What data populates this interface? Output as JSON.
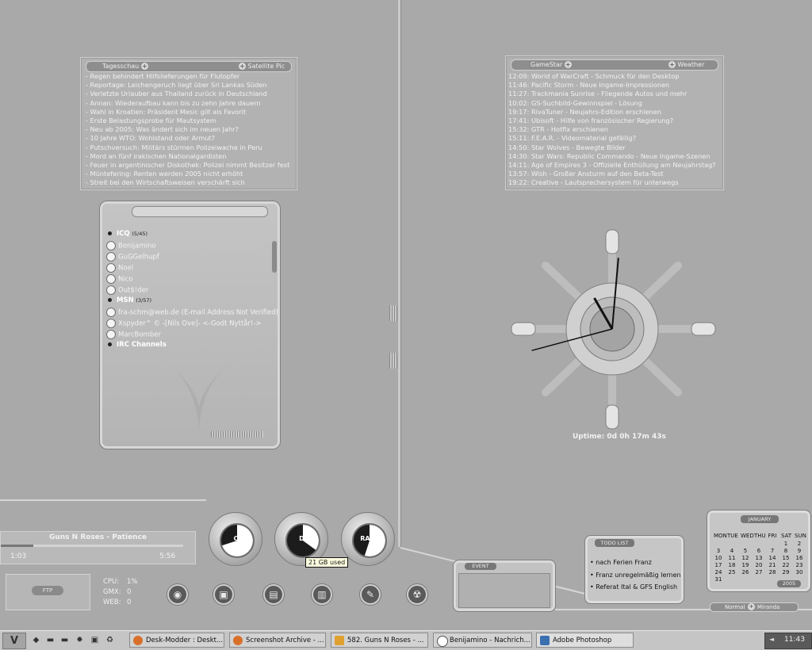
{
  "news_panel": {
    "left_tab": "Tagesschau",
    "right_tab": "Satellite Pic",
    "items": [
      "- Regen behindert Hilfslieferungen für Flutopfer",
      "- Reportage: Leichengeruch liegt über Sri Lankas Süden",
      "- Verletzte Urlauber aus Thailand zurück in Deutschland",
      "- Annan: Wiederaufbau kann bis zu zehn Jahre dauern",
      "- Wahl in Kroatien: Präsident Mesic gilt als Favorit",
      "- Erste Belastungsprobe für Mautsystem",
      "- Neu ab 2005: Was ändert sich im neuen Jahr?",
      "- 10 Jahre WTO: Wohlstand oder Armut?",
      "- Putschversuch: Militärs stürmen Polizeiwache in Peru",
      "- Mord an fünf irakischen Nationalgardisten",
      "- Feuer in argentinischer Diskothek: Polizei nimmt Besitzer fest",
      "- Müntefering: Renten werden 2005 nicht erhöht",
      "- Streit bei den Wirtschaftsweisen verschärft sich"
    ]
  },
  "gamestar_panel": {
    "left_tab": "GameStar",
    "right_tab": "Weather",
    "items": [
      "12:09: World of WarCraft - Schmuck für den Desktop",
      "11:46: Pacific Storm - Neue Ingame-Impressionen",
      "11:27: Trackmania Sunrise - Fliegende Autos und mehr",
      "10:02: GS-Suchbild-Gewinnspiel - Lösung",
      "19:17: RivaTuner - Neujahrs-Edition erschienen",
      "17:41: Ubisoft - Hilfe von französischer Regierung?",
      "15:32: GTR - Hotfix erschienen",
      "15:11: F.E.A.R. - Videomaterial gefällig?",
      "14:50: Star Wolves - Bewegte Bilder",
      "14:30: Star Wars: Republic Commando - Neue Ingame-Szenen",
      "14:11: Age of Empires 3 - Offizielle Enthüllung am Neujahrstag?",
      "13:57: Wish - Großer Ansturm auf den Beta-Test",
      "19:22: Creative - Lautsprechersystem für unterwegs"
    ]
  },
  "contacts": {
    "icq_label": "ICQ",
    "icq_count": "(5/45)",
    "icq": [
      "Benijamino",
      "GuGGelhupf",
      "Noel",
      "Nico",
      "Out$!der"
    ],
    "msn_label": "MSN",
    "msn_count": "(3/57)",
    "msn": [
      "fra-schm@web.de (E-mail Address Not Verified)",
      "Xspyder^ © -[Nils Ove]- <-Godt Nyttår!->",
      "MarcBomber"
    ],
    "irc_label": "IRC Channels"
  },
  "clock": {
    "uptime": "Uptime: 0d 0h 17m 43s",
    "hour_angle": 330,
    "minute_angle": 5,
    "second_angle": 255
  },
  "player": {
    "track": "Guns N Roses - Patience",
    "elapsed": "1:03",
    "total": "5:56",
    "progress": 0.18
  },
  "system": {
    "logo": "FTP",
    "cpu_label": "CPU:",
    "cpu_value": "1%",
    "gmx_label": "GMX:",
    "gmx_value": "0",
    "web_label": "WEB:",
    "web_value": "0"
  },
  "drives": [
    {
      "label": "C:",
      "used_fraction": 0.7
    },
    {
      "label": "D:",
      "used_fraction": 0.35
    },
    {
      "label": "RAM:",
      "used_fraction": 0.55
    }
  ],
  "drive_tooltip": "21 GB used",
  "dock_icons": [
    "cd-icon",
    "box-icon",
    "floppy-icon",
    "trash-icon",
    "pen-icon",
    "radiation-icon"
  ],
  "event_panel": {
    "title": "EVENT"
  },
  "todo": {
    "title": "TODO LIST",
    "items": [
      "nach Ferien Franz",
      "Franz unregelmäßig lernen",
      "Referat Ital & GFS English"
    ]
  },
  "calendar": {
    "month": "JANUARY",
    "year": "2005",
    "weekdays": [
      "MON",
      "TUE",
      "WED",
      "THU",
      "FRI",
      "SAT",
      "SUN"
    ],
    "weeks": [
      [
        "",
        "",
        "",
        "",
        "",
        "1",
        "2"
      ],
      [
        "3",
        "4",
        "5",
        "6",
        "7",
        "8",
        "9"
      ],
      [
        "10",
        "11",
        "12",
        "13",
        "14",
        "15",
        "16"
      ],
      [
        "17",
        "18",
        "19",
        "20",
        "21",
        "22",
        "23"
      ],
      [
        "24",
        "25",
        "26",
        "27",
        "28",
        "29",
        "30"
      ],
      [
        "31",
        "",
        "",
        "",
        "",
        "",
        ""
      ]
    ]
  },
  "miranda_bar": {
    "left": "Normal",
    "right": "Miranda"
  },
  "taskbar": {
    "start_logo": "V",
    "tasks": [
      {
        "label": "Desk-Modder : Deskt...",
        "icon": "firefox-icon",
        "color": "#d9702a"
      },
      {
        "label": "Screenshot Archive - ...",
        "icon": "firefox-icon",
        "color": "#d9702a"
      },
      {
        "label": "582. Guns N Roses - ...",
        "icon": "winamp-icon",
        "color": "#e0a030"
      },
      {
        "label": "Benijamino - Nachrich...",
        "icon": "miranda-icon",
        "color": "#ffffff"
      },
      {
        "label": "Adobe Photoshop",
        "icon": "photoshop-icon",
        "color": "#3c6fb0"
      }
    ],
    "clock": "11:43"
  }
}
